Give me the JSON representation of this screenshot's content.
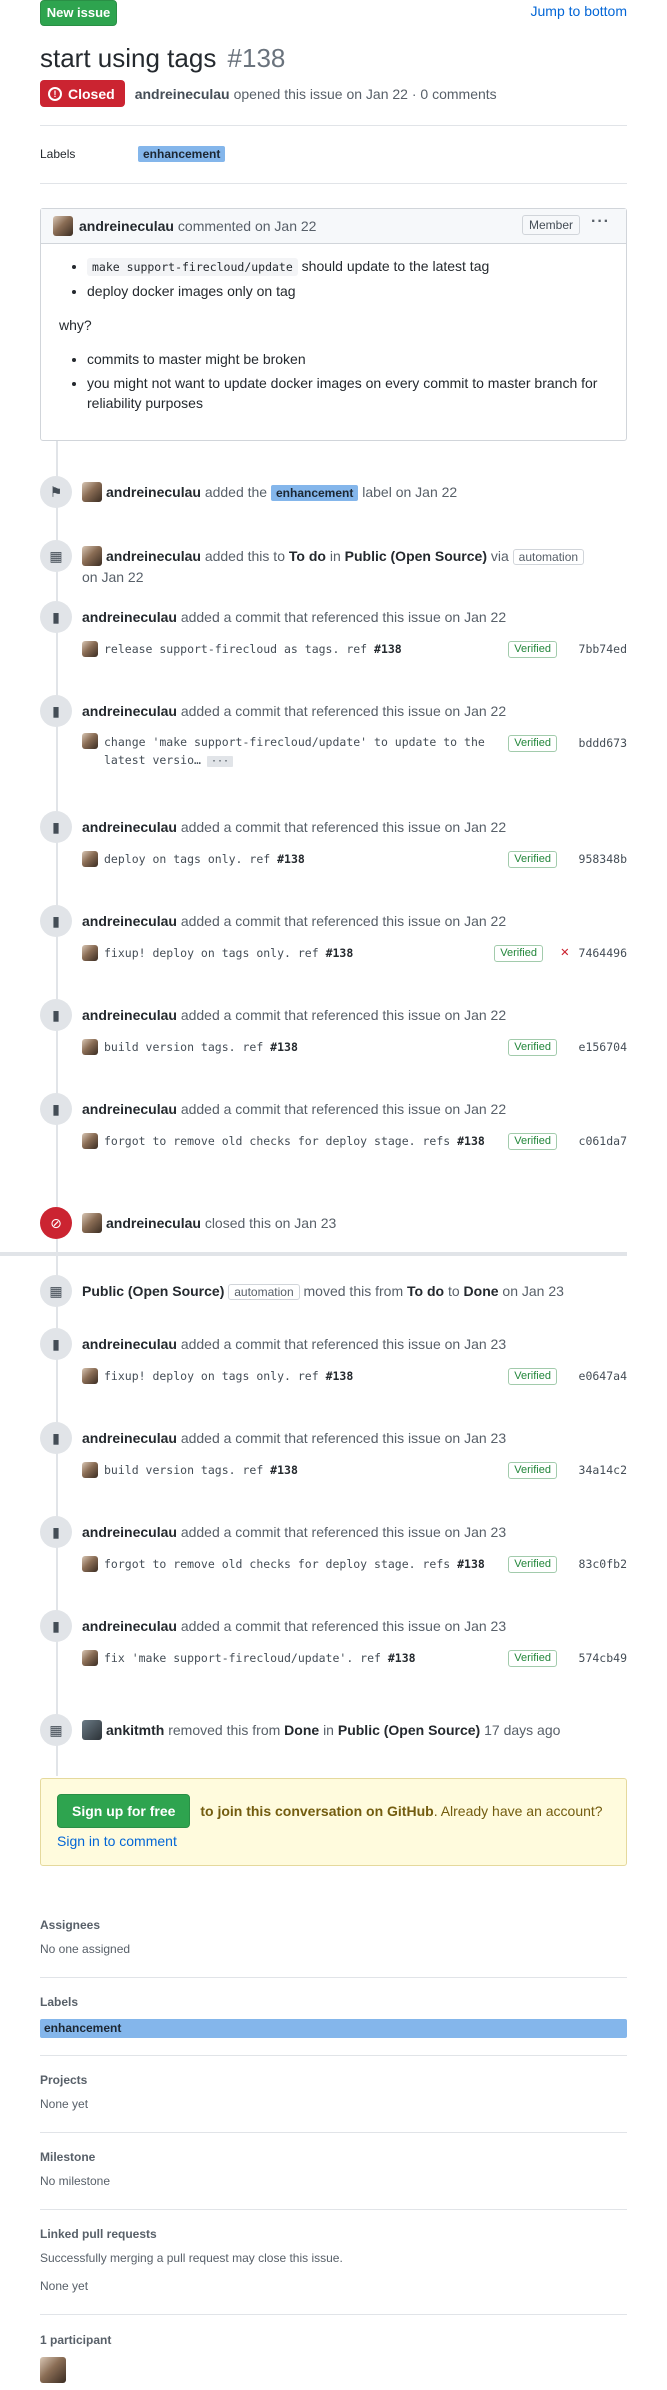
{
  "header": {
    "new_issue": "New issue",
    "jump": "Jump to bottom"
  },
  "issue": {
    "title": "start using tags",
    "number": "#138",
    "state": "Closed",
    "author": "andreineculau",
    "meta": "opened this issue on Jan 22 · 0 comments"
  },
  "labels_row": {
    "heading": "Labels",
    "label": "enhancement"
  },
  "comment": {
    "author": "andreineculau",
    "when": "commented on Jan 22",
    "role": "Member",
    "menu": "···",
    "list1": [
      {
        "code": "make support-firecloud/update",
        "text": " should update to the latest tag"
      },
      {
        "code": "",
        "text": "deploy docker images only on tag"
      }
    ],
    "why": "why?",
    "list2": [
      "commits to master might be broken",
      "you might not want to update docker images on every commit to master branch for reliability purposes"
    ]
  },
  "events": {
    "labeled": {
      "user": "andreineculau",
      "pre": "added the",
      "label": "enhancement",
      "post": "label on Jan 22"
    },
    "project_add": {
      "user": "andreineculau",
      "t1": "added this to",
      "col": "To do",
      "t2": "in",
      "proj": "Public (Open Source)",
      "t3": "via",
      "auto": "automation",
      "date": "on Jan 22"
    },
    "commit_text": "added a commit that referenced this issue",
    "c1": {
      "user": "andreineculau",
      "date": "on Jan 22",
      "msg": "release support-firecloud as tags. ref ",
      "ref": "#138",
      "verified": "Verified",
      "sha": "7bb74ed"
    },
    "c2": {
      "user": "andreineculau",
      "date": "on Jan 22",
      "msg1": "change 'make support-firecloud/update' to update to the",
      "msg2": "latest versio…",
      "ell": "···",
      "verified": "Verified",
      "sha": "bddd673"
    },
    "c3": {
      "user": "andreineculau",
      "date": "on Jan 22",
      "msg": "deploy on tags only. ref ",
      "ref": "#138",
      "verified": "Verified",
      "sha": "958348b"
    },
    "c4": {
      "user": "andreineculau",
      "date": "on Jan 22",
      "msg": "fixup! deploy on tags only. ref ",
      "ref": "#138",
      "verified": "Verified",
      "sha": "7464496"
    },
    "c5": {
      "user": "andreineculau",
      "date": "on Jan 22",
      "msg": "build version tags. ref ",
      "ref": "#138",
      "verified": "Verified",
      "sha": "e156704"
    },
    "c6": {
      "user": "andreineculau",
      "date": "on Jan 22",
      "msg": "forgot to remove old checks for deploy stage. refs ",
      "ref": "#138",
      "verified": "Verified",
      "sha": "c061da7"
    },
    "closed": {
      "user": "andreineculau",
      "text": "closed this on Jan 23"
    },
    "moved": {
      "proj": "Public (Open Source)",
      "auto": "automation",
      "t1": "moved this from",
      "from": "To do",
      "t2": "to",
      "to": "Done",
      "date": "on Jan 23"
    },
    "c7": {
      "user": "andreineculau",
      "date": "on Jan 23",
      "msg": "fixup! deploy on tags only. ref ",
      "ref": "#138",
      "verified": "Verified",
      "sha": "e0647a4"
    },
    "c8": {
      "user": "andreineculau",
      "date": "on Jan 23",
      "msg": "build version tags. ref ",
      "ref": "#138",
      "verified": "Verified",
      "sha": "34a14c2"
    },
    "c9": {
      "user": "andreineculau",
      "date": "on Jan 23",
      "msg": "forgot to remove old checks for deploy stage. refs ",
      "ref": "#138",
      "verified": "Verified",
      "sha": "83c0fb2"
    },
    "c10": {
      "user": "andreineculau",
      "date": "on Jan 23",
      "msg": "fix 'make support-firecloud/update'. ref ",
      "ref": "#138",
      "verified": "Verified",
      "sha": "574cb49"
    },
    "removed": {
      "user": "ankitmth",
      "t1": "removed this from",
      "col": "Done",
      "t2": "in",
      "proj": "Public (Open Source)",
      "date": "17 days ago"
    }
  },
  "signup": {
    "button": "Sign up for free",
    "bold": "to join this conversation on GitHub",
    "text": ". Already have an account? ",
    "link": "Sign in to comment"
  },
  "sidebar": {
    "assignees": {
      "title": "Assignees",
      "value": "No one assigned"
    },
    "labels": {
      "title": "Labels",
      "value": "enhancement"
    },
    "projects": {
      "title": "Projects",
      "value": "None yet"
    },
    "milestone": {
      "title": "Milestone",
      "value": "No milestone"
    },
    "linked": {
      "title": "Linked pull requests",
      "desc": "Successfully merging a pull request may close this issue.",
      "value": "None yet"
    },
    "participants": {
      "title": "1 participant"
    }
  }
}
